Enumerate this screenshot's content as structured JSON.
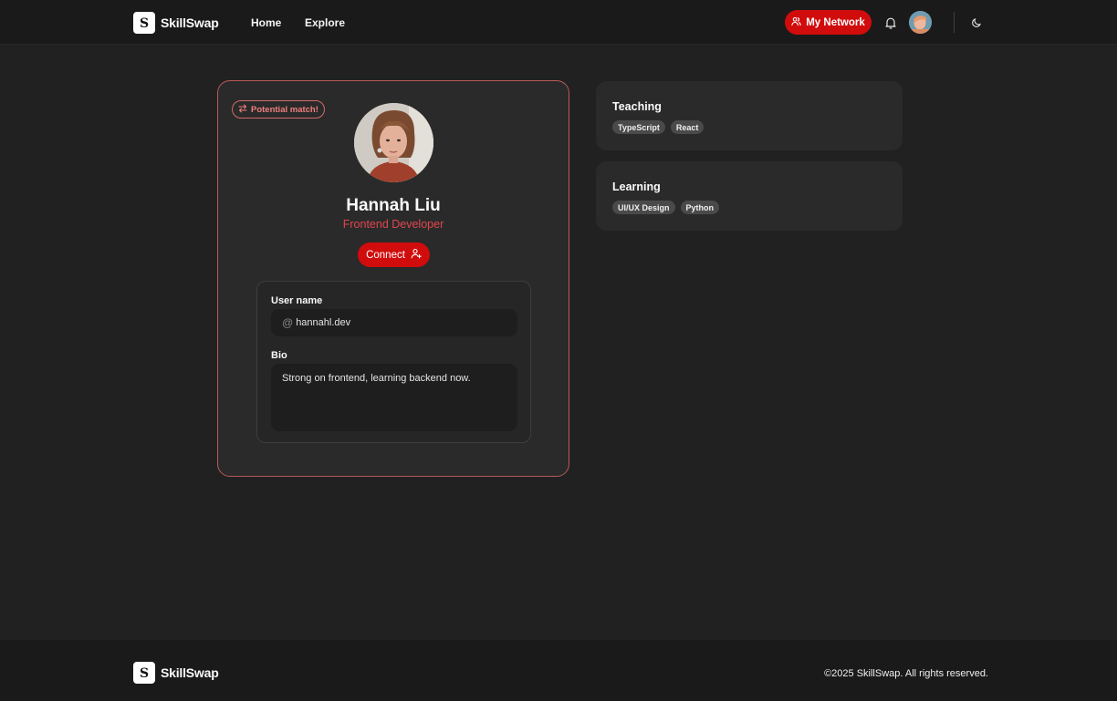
{
  "header": {
    "brand": "SkillSwap",
    "nav": {
      "home": "Home",
      "explore": "Explore"
    },
    "network_button": "My Network",
    "icons": [
      "users-icon",
      "bell-icon",
      "avatar",
      "moon-icon"
    ]
  },
  "profile": {
    "badge": "Potential match!",
    "name": "Hannah Liu",
    "title": "Frontend Developer",
    "connect_label": "Connect",
    "username_label": "User name",
    "username_prefix": "@",
    "username": "hannahl.dev",
    "bio_label": "Bio",
    "bio": "Strong on frontend, learning backend now."
  },
  "skills": {
    "teaching": {
      "title": "Teaching",
      "items": [
        "TypeScript",
        "React"
      ]
    },
    "learning": {
      "title": "Learning",
      "items": [
        "UI/UX Design",
        "Python"
      ]
    }
  },
  "footer": {
    "brand": "SkillSwap",
    "copyright": "©2025 SkillSwap. All rights reserved."
  },
  "colors": {
    "background": "#212121",
    "surface": "#2a2a2a",
    "accent": "#d10c0c",
    "accent_text": "#e0474f",
    "chip": "#4a4a4a"
  }
}
